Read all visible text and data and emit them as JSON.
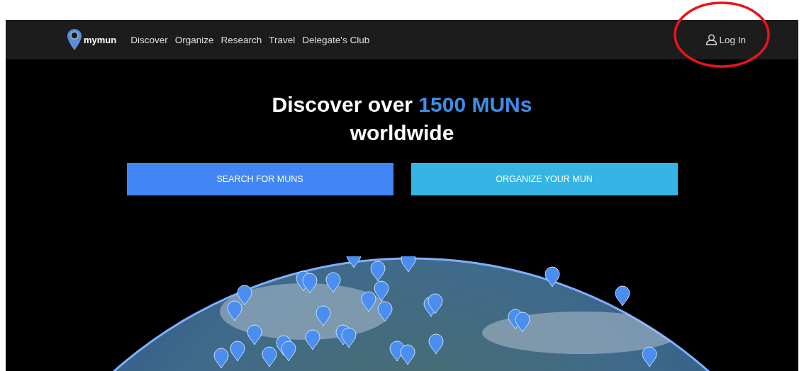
{
  "nav": {
    "brand": "mymun",
    "links": [
      "Discover",
      "Organize",
      "Research",
      "Travel",
      "Delegate's Club"
    ],
    "login": "Log In"
  },
  "hero": {
    "headline_before": "Discover over",
    "headline_highlight": "1500 MUNs",
    "headline_after": "worldwide",
    "buttons": [
      {
        "label": "SEARCH FOR MUNS",
        "kind": "primary"
      },
      {
        "label": "ORGANIZE YOUR MUN",
        "kind": "secondary"
      }
    ]
  },
  "annotation": {
    "circled": true
  }
}
